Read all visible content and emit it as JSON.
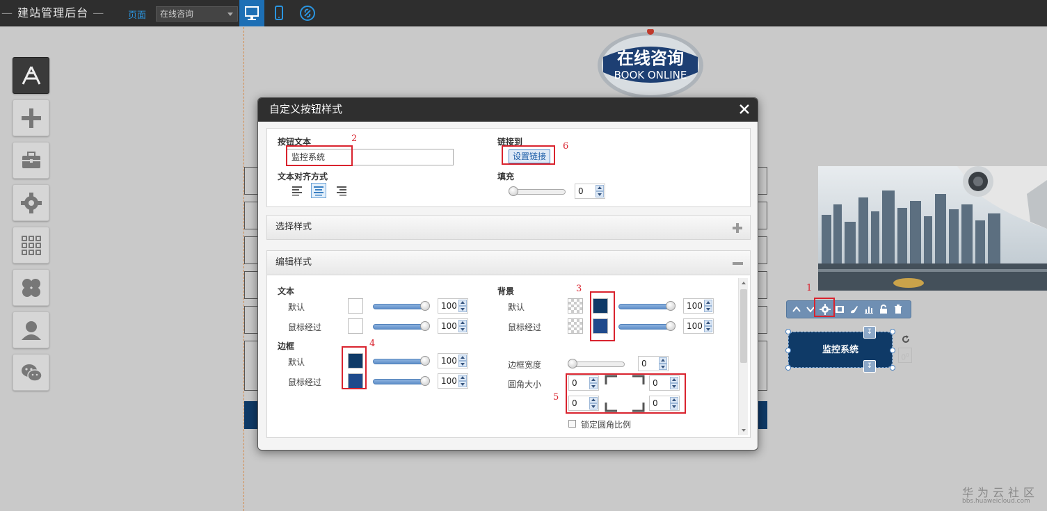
{
  "topbar": {
    "title": "建站管理后台",
    "page_label": "页面",
    "page_select_value": "在线咨询",
    "view_buttons": [
      "desktop-view",
      "mobile-view",
      "link-view"
    ]
  },
  "sidebar": {
    "items": [
      "app-store",
      "add",
      "toolbox",
      "settings",
      "grid",
      "modules",
      "user",
      "wechat"
    ]
  },
  "logo": {
    "line1": "在线咨询",
    "line2": "BOOK ONLINE"
  },
  "dialog": {
    "title": "自定义按钮样式",
    "button_text_label": "按钮文本",
    "button_text_value": "监控系统",
    "link_label": "链接到",
    "link_button": "设置链接",
    "align_label": "文本对齐方式",
    "fill_label": "填充",
    "fill_value": "0",
    "fill_level": 0,
    "choose_style": "选择样式",
    "edit_style": "编辑样式",
    "text_section": "文本",
    "text_default_label": "默认",
    "text_default_opacity": "100",
    "text_hover_label": "鼠标经过",
    "text_hover_opacity": "100",
    "border_section": "边框",
    "border_default_label": "默认",
    "border_default_opacity": "100",
    "border_hover_label": "鼠标经过",
    "border_hover_opacity": "100",
    "bg_section": "背景",
    "bg_default_label": "默认",
    "bg_default_opacity": "100",
    "bg_hover_label": "鼠标经过",
    "bg_hover_opacity": "100",
    "border_width_label": "边框宽度",
    "border_width_value": "0",
    "radius_label": "圆角大小",
    "radius_tl": "0",
    "radius_tr": "0",
    "radius_bl": "0",
    "radius_br": "0",
    "lock_ratio": "锁定圆角比例"
  },
  "canvas_button": {
    "label": "监控系统",
    "angle": "0"
  },
  "annotations": [
    "1",
    "2",
    "3",
    "4",
    "5",
    "6"
  ],
  "watermark": {
    "line1": "华为云社区",
    "line2": "bbs.huaweicloud.com"
  },
  "colors": {
    "accent_blue": "#1d6fb5",
    "button_navy": "#0f3a67",
    "hover_blue": "#1f4a8c",
    "annotation_red": "#d9232e"
  }
}
